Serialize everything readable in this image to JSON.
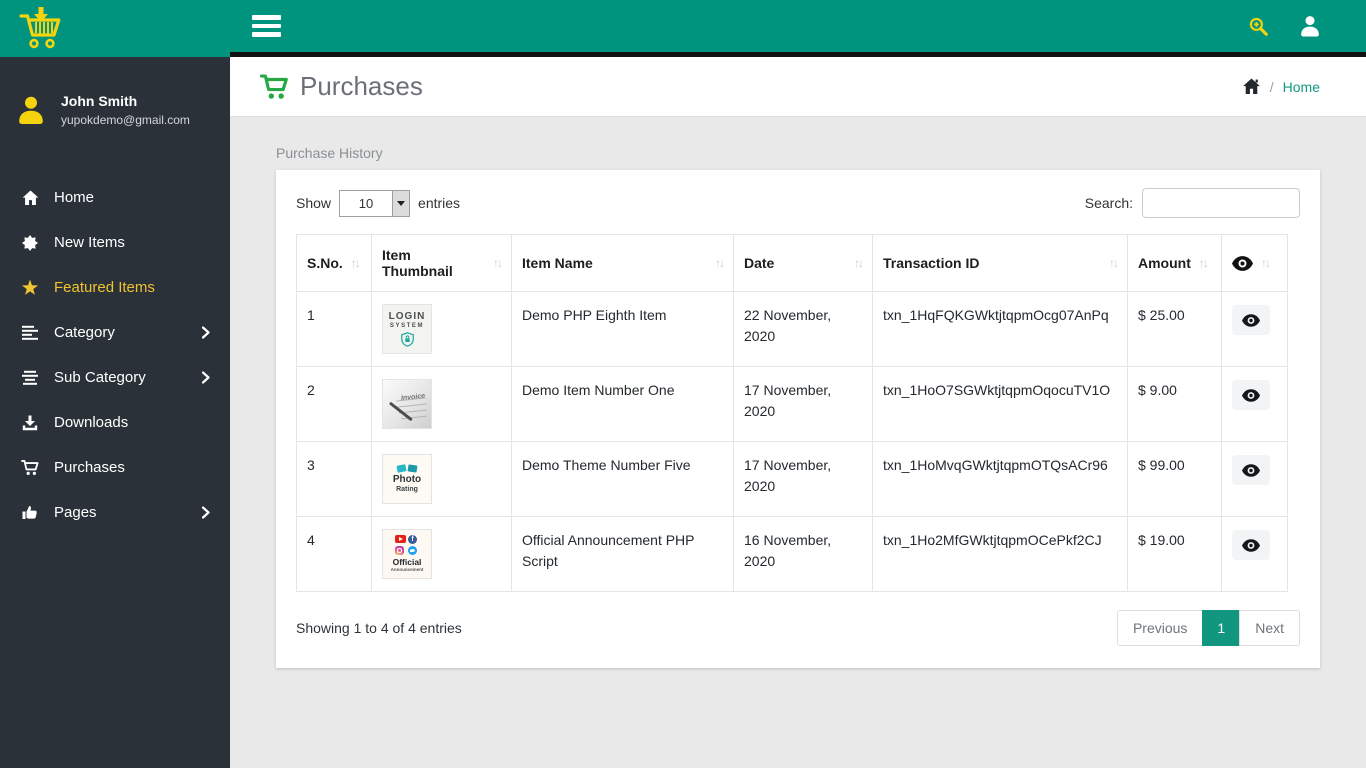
{
  "colors": {
    "teal": "#00947E",
    "green": "#28a745",
    "yellow": "#F5D40E",
    "sidebar_bg": "#2a3138",
    "pagination_active": "#11967F"
  },
  "topbar": {
    "hamburger_icon": "hamburger-menu",
    "search_icon": "search-plus",
    "user_icon": "user-silhouette"
  },
  "sidebar": {
    "logo_icon": "cart-with-download-arrow",
    "user": {
      "name": "John Smith",
      "email": "yupokdemo@gmail.com"
    },
    "items": [
      {
        "label": "Home",
        "icon": "home-icon",
        "active": false,
        "has_submenu": false
      },
      {
        "label": "New Items",
        "icon": "burst-icon",
        "active": false,
        "has_submenu": false
      },
      {
        "label": "Featured Items",
        "icon": "star-icon",
        "active": true,
        "has_submenu": false
      },
      {
        "label": "Category",
        "icon": "list-icon",
        "active": false,
        "has_submenu": true
      },
      {
        "label": "Sub Category",
        "icon": "list-centered-icon",
        "active": false,
        "has_submenu": true
      },
      {
        "label": "Downloads",
        "icon": "download-icon",
        "active": false,
        "has_submenu": false
      },
      {
        "label": "Purchases",
        "icon": "cart-icon",
        "active": false,
        "has_submenu": false
      },
      {
        "label": "Pages",
        "icon": "thumbs-up-icon",
        "active": false,
        "has_submenu": true
      }
    ]
  },
  "header": {
    "title": "Purchases",
    "title_icon": "cart-icon",
    "breadcrumb_home_icon": "home-icon",
    "breadcrumb_separator": "/",
    "breadcrumb_home": "Home"
  },
  "content": {
    "section_label": "Purchase History",
    "controls": {
      "show_label": "Show",
      "page_size": "10",
      "entries_label": "entries",
      "search_label": "Search:",
      "search_value": ""
    },
    "table": {
      "sort_icon": "↑↓",
      "columns": [
        "S.No.",
        "Item Thumbnail",
        "Item Name",
        "Date",
        "Transaction ID",
        "Amount"
      ],
      "view_column_icon": "eye-icon",
      "thumbnails": {
        "login": {
          "line1": "LOGIN",
          "line2": "SYSTEM",
          "icon": "shield-lock-icon"
        },
        "invoice": {
          "label": "Invoice"
        },
        "photo": {
          "line1": "Photo",
          "line2": "Rating"
        },
        "official": {
          "line1": "Official",
          "line2": "Announcement"
        }
      },
      "rows": [
        {
          "sno": "1",
          "thumb": "login-system-thumbnail",
          "name": "Demo PHP Eighth Item",
          "date": "22 November, 2020",
          "txn": "txn_1HqFQKGWktjtqpmOcg07AnPq",
          "amount": "$ 25.00"
        },
        {
          "sno": "2",
          "thumb": "invoice-thumbnail",
          "name": "Demo Item Number One",
          "date": "17 November, 2020",
          "txn": "txn_1HoO7SGWktjtqpmOqocuTV1O",
          "amount": "$ 9.00"
        },
        {
          "sno": "3",
          "thumb": "photo-rating-thumbnail",
          "name": "Demo Theme Number Five",
          "date": "17 November, 2020",
          "txn": "txn_1HoMvqGWktjtqpmOTQsACr96",
          "amount": "$ 99.00"
        },
        {
          "sno": "4",
          "thumb": "official-announcement-thumbnail",
          "name": "Official Announcement PHP Script",
          "date": "16 November, 2020",
          "txn": "txn_1Ho2MfGWktjtqpmOCePkf2CJ",
          "amount": "$ 19.00"
        }
      ]
    },
    "footer": {
      "summary": "Showing 1 to 4 of 4 entries",
      "previous": "Previous",
      "page": "1",
      "next": "Next"
    }
  }
}
